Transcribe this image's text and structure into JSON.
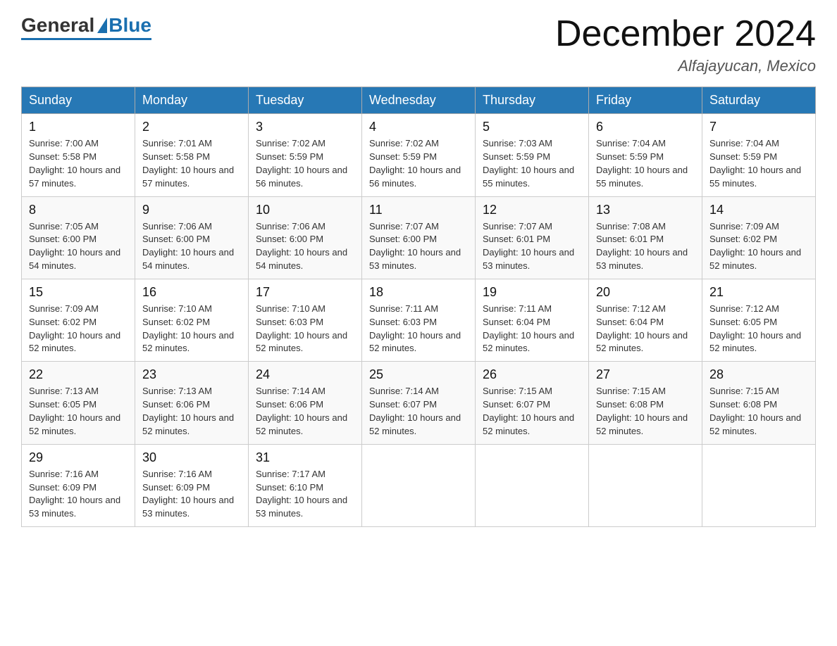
{
  "header": {
    "logo_general": "General",
    "logo_blue": "Blue",
    "month_title": "December 2024",
    "location": "Alfajayucan, Mexico"
  },
  "days_of_week": [
    "Sunday",
    "Monday",
    "Tuesday",
    "Wednesday",
    "Thursday",
    "Friday",
    "Saturday"
  ],
  "weeks": [
    [
      {
        "day": "1",
        "sunrise": "7:00 AM",
        "sunset": "5:58 PM",
        "daylight": "10 hours and 57 minutes."
      },
      {
        "day": "2",
        "sunrise": "7:01 AM",
        "sunset": "5:58 PM",
        "daylight": "10 hours and 57 minutes."
      },
      {
        "day": "3",
        "sunrise": "7:02 AM",
        "sunset": "5:59 PM",
        "daylight": "10 hours and 56 minutes."
      },
      {
        "day": "4",
        "sunrise": "7:02 AM",
        "sunset": "5:59 PM",
        "daylight": "10 hours and 56 minutes."
      },
      {
        "day": "5",
        "sunrise": "7:03 AM",
        "sunset": "5:59 PM",
        "daylight": "10 hours and 55 minutes."
      },
      {
        "day": "6",
        "sunrise": "7:04 AM",
        "sunset": "5:59 PM",
        "daylight": "10 hours and 55 minutes."
      },
      {
        "day": "7",
        "sunrise": "7:04 AM",
        "sunset": "5:59 PM",
        "daylight": "10 hours and 55 minutes."
      }
    ],
    [
      {
        "day": "8",
        "sunrise": "7:05 AM",
        "sunset": "6:00 PM",
        "daylight": "10 hours and 54 minutes."
      },
      {
        "day": "9",
        "sunrise": "7:06 AM",
        "sunset": "6:00 PM",
        "daylight": "10 hours and 54 minutes."
      },
      {
        "day": "10",
        "sunrise": "7:06 AM",
        "sunset": "6:00 PM",
        "daylight": "10 hours and 54 minutes."
      },
      {
        "day": "11",
        "sunrise": "7:07 AM",
        "sunset": "6:00 PM",
        "daylight": "10 hours and 53 minutes."
      },
      {
        "day": "12",
        "sunrise": "7:07 AM",
        "sunset": "6:01 PM",
        "daylight": "10 hours and 53 minutes."
      },
      {
        "day": "13",
        "sunrise": "7:08 AM",
        "sunset": "6:01 PM",
        "daylight": "10 hours and 53 minutes."
      },
      {
        "day": "14",
        "sunrise": "7:09 AM",
        "sunset": "6:02 PM",
        "daylight": "10 hours and 52 minutes."
      }
    ],
    [
      {
        "day": "15",
        "sunrise": "7:09 AM",
        "sunset": "6:02 PM",
        "daylight": "10 hours and 52 minutes."
      },
      {
        "day": "16",
        "sunrise": "7:10 AM",
        "sunset": "6:02 PM",
        "daylight": "10 hours and 52 minutes."
      },
      {
        "day": "17",
        "sunrise": "7:10 AM",
        "sunset": "6:03 PM",
        "daylight": "10 hours and 52 minutes."
      },
      {
        "day": "18",
        "sunrise": "7:11 AM",
        "sunset": "6:03 PM",
        "daylight": "10 hours and 52 minutes."
      },
      {
        "day": "19",
        "sunrise": "7:11 AM",
        "sunset": "6:04 PM",
        "daylight": "10 hours and 52 minutes."
      },
      {
        "day": "20",
        "sunrise": "7:12 AM",
        "sunset": "6:04 PM",
        "daylight": "10 hours and 52 minutes."
      },
      {
        "day": "21",
        "sunrise": "7:12 AM",
        "sunset": "6:05 PM",
        "daylight": "10 hours and 52 minutes."
      }
    ],
    [
      {
        "day": "22",
        "sunrise": "7:13 AM",
        "sunset": "6:05 PM",
        "daylight": "10 hours and 52 minutes."
      },
      {
        "day": "23",
        "sunrise": "7:13 AM",
        "sunset": "6:06 PM",
        "daylight": "10 hours and 52 minutes."
      },
      {
        "day": "24",
        "sunrise": "7:14 AM",
        "sunset": "6:06 PM",
        "daylight": "10 hours and 52 minutes."
      },
      {
        "day": "25",
        "sunrise": "7:14 AM",
        "sunset": "6:07 PM",
        "daylight": "10 hours and 52 minutes."
      },
      {
        "day": "26",
        "sunrise": "7:15 AM",
        "sunset": "6:07 PM",
        "daylight": "10 hours and 52 minutes."
      },
      {
        "day": "27",
        "sunrise": "7:15 AM",
        "sunset": "6:08 PM",
        "daylight": "10 hours and 52 minutes."
      },
      {
        "day": "28",
        "sunrise": "7:15 AM",
        "sunset": "6:08 PM",
        "daylight": "10 hours and 52 minutes."
      }
    ],
    [
      {
        "day": "29",
        "sunrise": "7:16 AM",
        "sunset": "6:09 PM",
        "daylight": "10 hours and 53 minutes."
      },
      {
        "day": "30",
        "sunrise": "7:16 AM",
        "sunset": "6:09 PM",
        "daylight": "10 hours and 53 minutes."
      },
      {
        "day": "31",
        "sunrise": "7:17 AM",
        "sunset": "6:10 PM",
        "daylight": "10 hours and 53 minutes."
      },
      null,
      null,
      null,
      null
    ]
  ]
}
